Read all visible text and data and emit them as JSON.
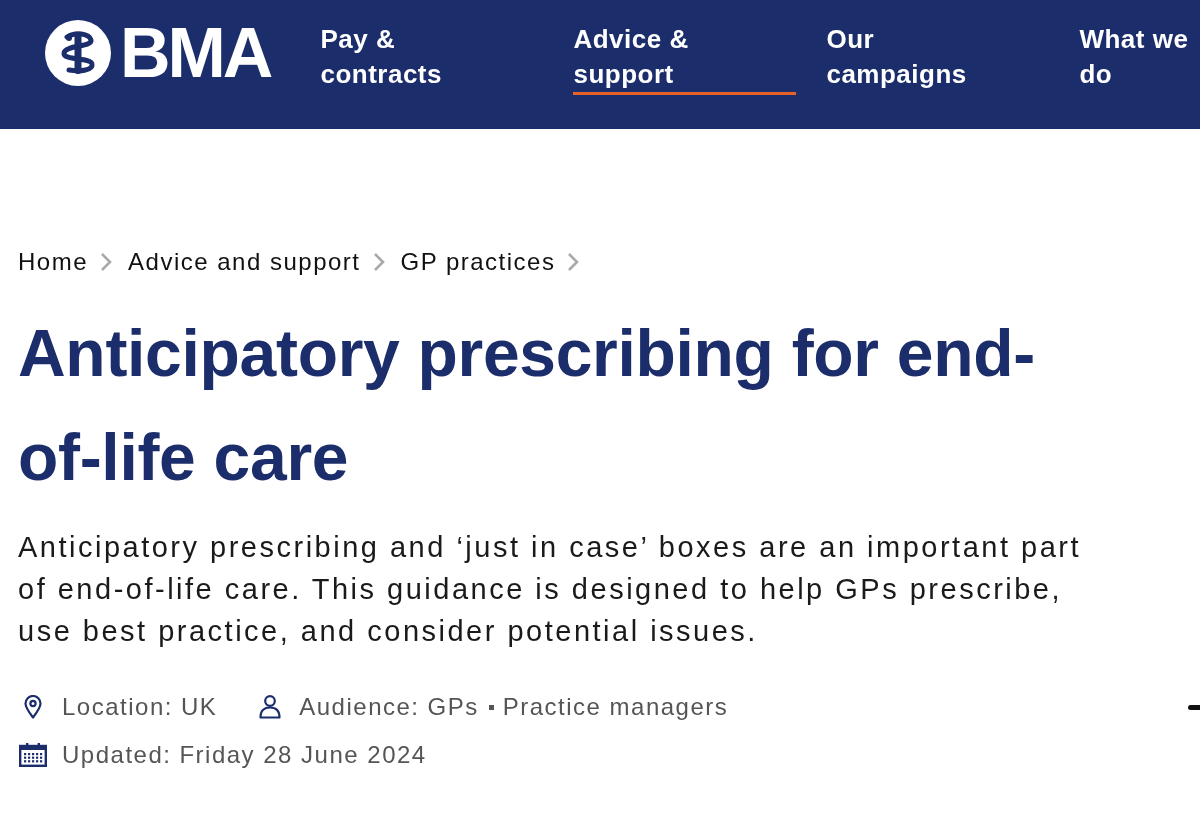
{
  "header": {
    "logo": {
      "text": "BMA"
    },
    "nav": [
      {
        "label": "Pay & contracts",
        "selected": false
      },
      {
        "label": "Advice & support",
        "selected": true
      },
      {
        "label": "Our campaigns",
        "selected": false
      },
      {
        "label": "What we do",
        "selected": false
      }
    ]
  },
  "breadcrumbs": [
    "Home",
    "Advice and support",
    "GP practices"
  ],
  "page": {
    "title": "Anticipatory prescribing for end-of-life care",
    "summary": "Anticipatory prescribing and ‘just in case’ boxes are an important part of end-of-life care. This guidance is designed to help GPs prescribe, use best practice, and consider potential issues."
  },
  "meta": {
    "rows": [
      {
        "items": [
          {
            "kind": "location",
            "label": "Location:",
            "values": [
              "UK"
            ]
          },
          {
            "kind": "audience",
            "label": "Audience:",
            "values": [
              "GPs",
              "Practice managers"
            ]
          }
        ]
      },
      {
        "items": [
          {
            "kind": "updated",
            "label": "Updated:",
            "values": [
              "Friday 28 June 2024"
            ]
          }
        ]
      }
    ]
  }
}
